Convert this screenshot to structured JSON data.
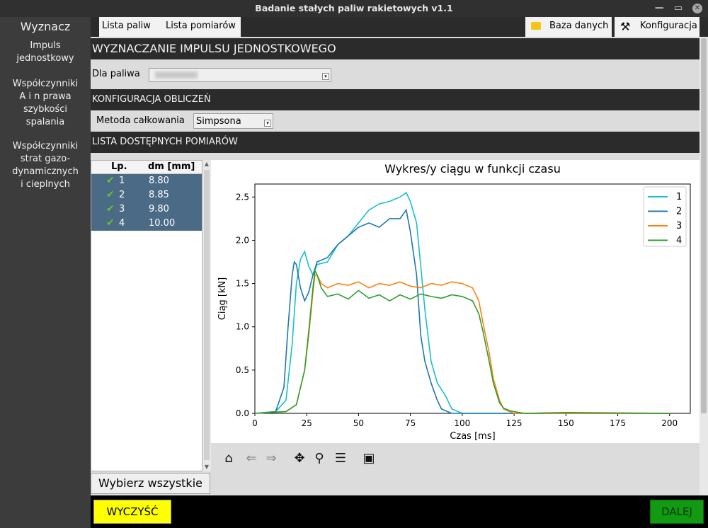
{
  "window": {
    "title": "Badanie stałych paliw rakietowych v1.1"
  },
  "sidebar": {
    "heading": "Wyznacz",
    "items": [
      {
        "label": "Impuls\njednostkowy"
      },
      {
        "label": "Współczynniki\nA i n prawa\nszybkości\nspalania"
      },
      {
        "label": "Współczynniki\nstrat gazo-\ndynamicznych\ni cieplnych"
      }
    ]
  },
  "tabs": [
    {
      "label": "Lista paliw"
    },
    {
      "label": "Lista pomiarów"
    }
  ],
  "toolbar": {
    "database_label": "Baza danych",
    "config_label": "Konfiguracja"
  },
  "page": {
    "title": "WYZNACZANIE IMPULSU JEDNOSTKOWEGO",
    "fuel_label": "Dla paliwa",
    "config_header": "KONFIGURACJA OBLICZEŃ",
    "method_label": "Metoda całkowania",
    "method_value": "Simpsona",
    "list_header": "LISTA DOSTĘPNYCH POMIARÓW"
  },
  "measurements": {
    "columns": [
      "Lp.",
      "dm [mm]"
    ],
    "rows": [
      {
        "lp": "1",
        "dm": "8.80"
      },
      {
        "lp": "2",
        "dm": "8.85"
      },
      {
        "lp": "3",
        "dm": "9.80"
      },
      {
        "lp": "4",
        "dm": "10.00"
      }
    ],
    "select_all_label": "Wybierz wszystkie"
  },
  "buttons": {
    "clear_label": "WYCZYŚĆ",
    "next_label": "DALEJ"
  },
  "colors": {
    "s1": "#17becf",
    "s2": "#1f77b4",
    "s3": "#ff7f0e",
    "s4": "#2ca02c"
  },
  "chart_data": {
    "type": "line",
    "title": "Wykres/y ciągu w funkcji czasu",
    "xlabel": "Czas [ms]",
    "ylabel": "Ciąg [kN]",
    "xlim": [
      0,
      210
    ],
    "ylim": [
      0,
      2.65
    ],
    "xticks": [
      0,
      25,
      50,
      75,
      100,
      125,
      150,
      175,
      200
    ],
    "yticks": [
      0.0,
      0.5,
      1.0,
      1.5,
      2.0,
      2.5
    ],
    "legend_position": "top-right",
    "series": [
      {
        "name": "1",
        "color": "#17becf",
        "x": [
          0,
          10,
          15,
          18,
          20,
          22,
          24,
          26,
          28,
          30,
          35,
          40,
          45,
          50,
          55,
          60,
          65,
          70,
          73,
          75,
          78,
          80,
          82,
          85,
          88,
          92,
          95,
          100,
          200
        ],
        "y": [
          0,
          0.02,
          0.15,
          0.8,
          1.5,
          1.78,
          1.87,
          1.7,
          1.6,
          1.72,
          1.75,
          1.95,
          2.05,
          2.2,
          2.35,
          2.42,
          2.45,
          2.5,
          2.55,
          2.45,
          2.2,
          1.7,
          1.2,
          0.6,
          0.35,
          0.2,
          0.05,
          0,
          0
        ]
      },
      {
        "name": "2",
        "color": "#1f77b4",
        "x": [
          0,
          10,
          14,
          16,
          18,
          19,
          20,
          22,
          24,
          26,
          28,
          30,
          35,
          40,
          45,
          50,
          55,
          60,
          65,
          70,
          73,
          75,
          78,
          80,
          82,
          85,
          88,
          90,
          95,
          200
        ],
        "y": [
          0,
          0.02,
          0.3,
          1.0,
          1.6,
          1.75,
          1.72,
          1.45,
          1.3,
          1.4,
          1.6,
          1.75,
          1.8,
          1.95,
          2.05,
          2.15,
          2.2,
          2.15,
          2.25,
          2.25,
          2.35,
          2.1,
          1.6,
          0.9,
          0.6,
          0.35,
          0.15,
          0.05,
          0,
          0
        ]
      },
      {
        "name": "3",
        "color": "#ff7f0e",
        "x": [
          0,
          15,
          20,
          24,
          26,
          28,
          29,
          30,
          32,
          35,
          40,
          45,
          50,
          55,
          60,
          65,
          70,
          75,
          80,
          85,
          90,
          95,
          100,
          105,
          108,
          110,
          113,
          115,
          118,
          120,
          123,
          125,
          130,
          200
        ],
        "y": [
          0,
          0.02,
          0.1,
          0.5,
          0.9,
          1.4,
          1.6,
          1.6,
          1.5,
          1.45,
          1.5,
          1.48,
          1.52,
          1.45,
          1.5,
          1.48,
          1.52,
          1.47,
          1.45,
          1.5,
          1.48,
          1.52,
          1.5,
          1.45,
          1.3,
          1.05,
          0.7,
          0.4,
          0.15,
          0.05,
          0.02,
          0,
          0,
          0
        ]
      },
      {
        "name": "4",
        "color": "#2ca02c",
        "x": [
          0,
          15,
          20,
          24,
          26,
          28,
          29,
          30,
          32,
          35,
          40,
          45,
          50,
          55,
          60,
          65,
          70,
          75,
          80,
          85,
          90,
          95,
          100,
          105,
          108,
          110,
          113,
          115,
          118,
          120,
          123,
          125,
          130,
          150,
          200
        ],
        "y": [
          0,
          0.02,
          0.1,
          0.5,
          0.95,
          1.45,
          1.65,
          1.6,
          1.45,
          1.35,
          1.38,
          1.32,
          1.42,
          1.33,
          1.37,
          1.3,
          1.37,
          1.32,
          1.38,
          1.35,
          1.33,
          1.37,
          1.35,
          1.3,
          1.15,
          0.95,
          0.6,
          0.35,
          0.12,
          0.06,
          0.03,
          0.02,
          0,
          0.01,
          0
        ]
      }
    ]
  }
}
